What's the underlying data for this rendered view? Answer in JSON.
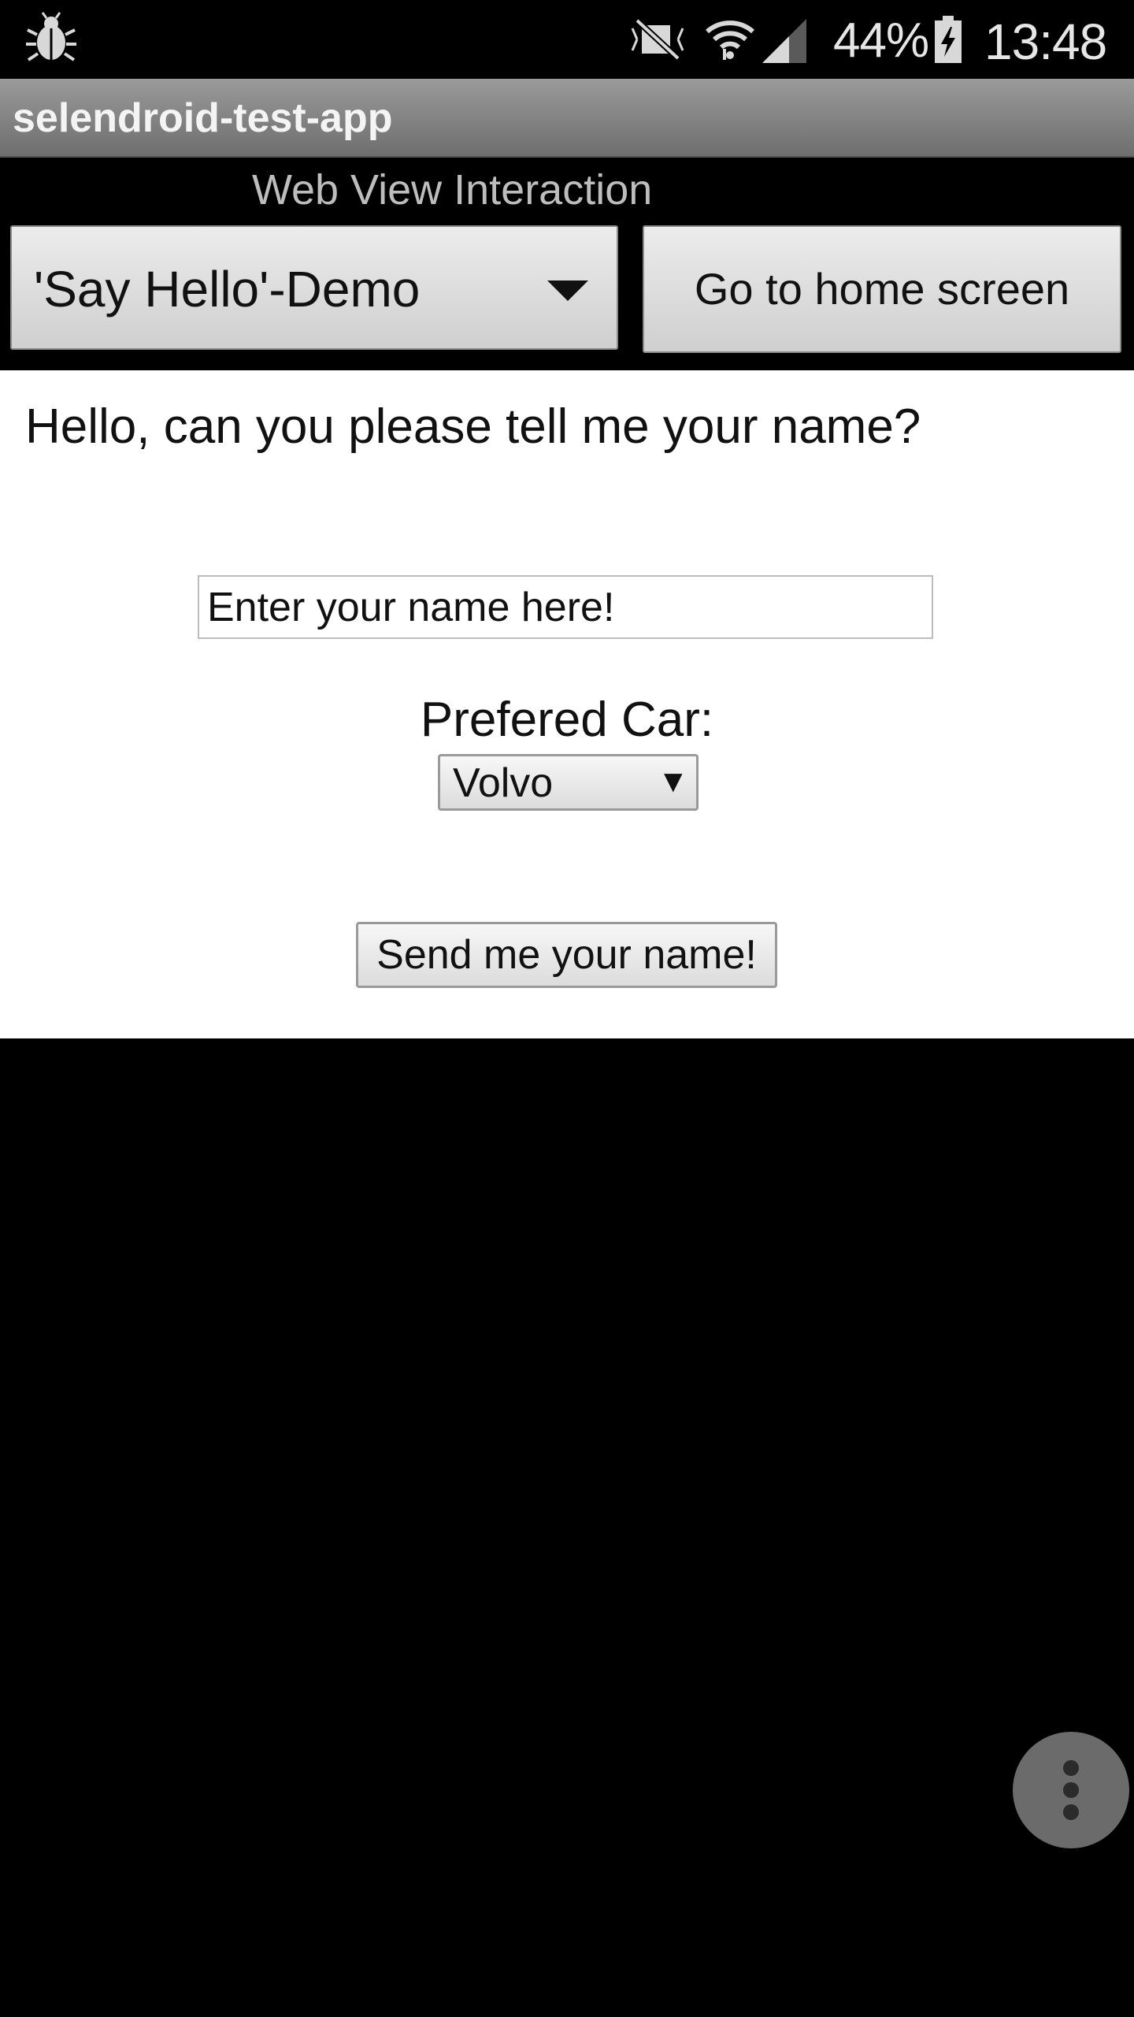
{
  "status_bar": {
    "battery_percent": "44%",
    "time": "13:48",
    "icons": [
      "bug-icon",
      "mute-vibrate-icon",
      "wifi-icon",
      "cell-signal-icon",
      "battery-charging-icon"
    ]
  },
  "app_bar": {
    "title": "selendroid-test-app"
  },
  "header": {
    "section_title": "Web View Interaction",
    "spinner_value": "'Say Hello'-Demo",
    "home_button_label": "Go to home screen"
  },
  "webview": {
    "question": "Hello, can you please tell me your name?",
    "name_input_placeholder": "Enter your name here!",
    "car_label": "Prefered Car:",
    "car_select_value": "Volvo",
    "send_button_label": "Send me your name!"
  },
  "colors": {
    "background": "#000000",
    "app_bar_gradient_top": "#9a9a9a",
    "app_bar_gradient_bottom": "#6e6e6e",
    "webview_background": "#ffffff",
    "fab_background": "#6b6b6b"
  }
}
